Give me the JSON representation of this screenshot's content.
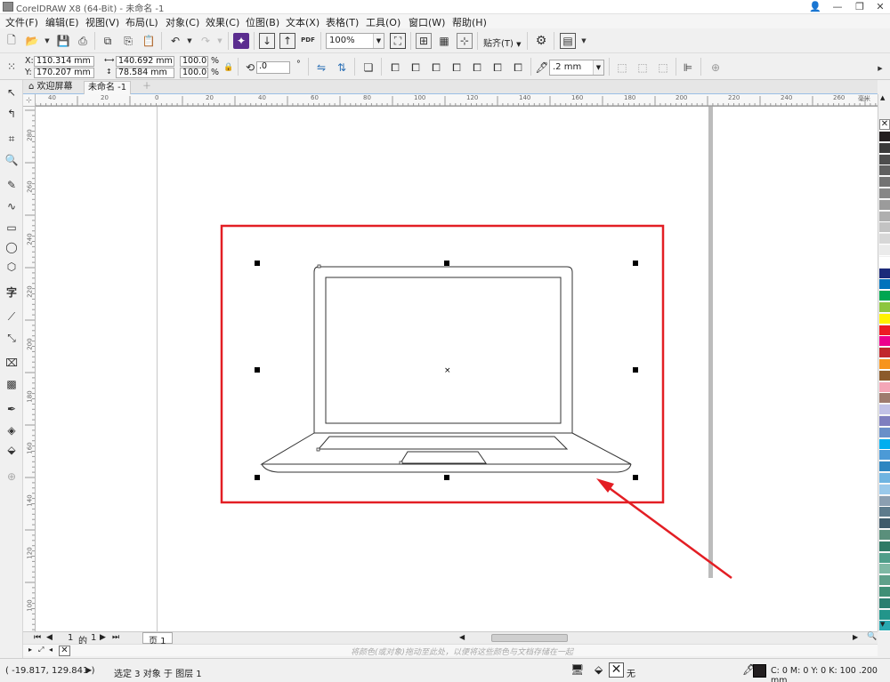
{
  "window": {
    "title": "CorelDRAW X8 (64-Bit) - 未命名 -1"
  },
  "menu": [
    "文件(F)",
    "编辑(E)",
    "视图(V)",
    "布局(L)",
    "对象(C)",
    "效果(C)",
    "位图(B)",
    "文本(X)",
    "表格(T)",
    "工具(O)",
    "窗口(W)",
    "帮助(H)"
  ],
  "toolbar": {
    "zoom_value": "100%",
    "snap_label": "贴齐(T)",
    "pdf_label": "PDF"
  },
  "property_bar": {
    "x_label": "X:",
    "x_value": "110.314 mm",
    "y_label": "Y:",
    "y_value": "170.207 mm",
    "width_value": "140.692 mm",
    "height_value": "78.584 mm",
    "scale_w": "100.0",
    "scale_h": "100.0",
    "percent": "%",
    "rotation_value": ".0",
    "outline_width": ".2 mm"
  },
  "tabs": {
    "welcome": "欢迎屏幕",
    "document": "未命名 -1"
  },
  "ruler": {
    "h_ticks": [
      "40",
      "20",
      "0",
      "20",
      "40",
      "60",
      "80",
      "100",
      "120",
      "140",
      "160",
      "180",
      "200",
      "220",
      "240",
      "260"
    ],
    "unit": "毫米",
    "v_ticks": [
      "280",
      "260",
      "240",
      "220",
      "200",
      "180",
      "160",
      "140",
      "120",
      "100",
      "80"
    ]
  },
  "page_nav": {
    "current": "1",
    "of": "的",
    "total": "1",
    "page_tab": "页 1"
  },
  "hint": "将颜色(或对象)拖动至此处，以便将这些颜色与文档存储在一起",
  "status": {
    "coords": "( -19.817, 129.841 )",
    "selection": "选定 3 对象 于 图层 1",
    "fill_none": "无",
    "outline_info": "C: 0 M: 0 Y: 0 K: 100  .200 mm"
  },
  "colors": {
    "highlight_red": "#e31e24",
    "accent_blue": "#1e7bd6",
    "palette": [
      "#231f20",
      "#3a3a3a",
      "#4d4d4d",
      "#606060",
      "#737373",
      "#878787",
      "#9b9b9b",
      "#afafaf",
      "#c3c3c3",
      "#d7d7d7",
      "#ebebeb",
      "#ffffff",
      "#1b2a7a",
      "#0072bc",
      "#00a651",
      "#8dc63f",
      "#fff200",
      "#ed1c24",
      "#ec008c",
      "#c1272d",
      "#f7941d",
      "#8b5a2b",
      "#f4a6b7",
      "#9e7b6e",
      "#c2c2e6",
      "#7f7fbf",
      "#6a8fc8",
      "#00aeef",
      "#4c9ad6",
      "#2e86c1",
      "#6fb4e1",
      "#9ac9ea",
      "#8c9fb1",
      "#5e7b8c",
      "#3f5b6b",
      "#5a8f7b",
      "#2f7a66",
      "#4f9e8a",
      "#7fb8a4",
      "#5fa08a",
      "#3f8f76",
      "#2a7f70",
      "#22958a",
      "#28a8b0"
    ]
  }
}
